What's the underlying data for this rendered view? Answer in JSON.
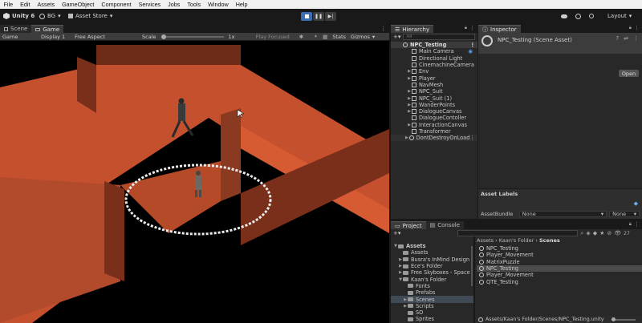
{
  "menu": [
    "File",
    "Edit",
    "Assets",
    "GameObject",
    "Component",
    "Services",
    "Jobs",
    "Tools",
    "Window",
    "Help"
  ],
  "toolbar": {
    "app": "Unity 6",
    "account": "BG",
    "asset_store": "Asset Store",
    "layout": "Layout"
  },
  "scene_tabs": {
    "scene": "Scene",
    "game": "Game"
  },
  "game_bar": {
    "mode": "Game",
    "display": "Display 1",
    "aspect": "Free Aspect",
    "scale_label": "Scale",
    "scale_value": "1x",
    "play_focused": "Play Focused",
    "stats": "Stats",
    "gizmos": "Gizmos"
  },
  "hierarchy": {
    "tab": "Hierarchy",
    "search_placeholder": "All",
    "scene": "NPC_Testing",
    "items": [
      {
        "label": "Main Camera",
        "indent": 1,
        "arrow": false
      },
      {
        "label": "Directional Light",
        "indent": 1,
        "arrow": false
      },
      {
        "label": "CinemachineCamera",
        "indent": 1,
        "arrow": false
      },
      {
        "label": "Env",
        "indent": 1,
        "arrow": true
      },
      {
        "label": "Player",
        "indent": 1,
        "arrow": true
      },
      {
        "label": "NavMesh",
        "indent": 1,
        "arrow": false
      },
      {
        "label": "NPC_Suit",
        "indent": 1,
        "arrow": true
      },
      {
        "label": "NPC_Suit (1)",
        "indent": 1,
        "arrow": true
      },
      {
        "label": "WanderPoints",
        "indent": 1,
        "arrow": true
      },
      {
        "label": "DialogueCanvas",
        "indent": 1,
        "arrow": true
      },
      {
        "label": "DialogueContoller",
        "indent": 1,
        "arrow": false
      },
      {
        "label": "InteractionCanvas",
        "indent": 1,
        "arrow": true
      },
      {
        "label": "Transformer",
        "indent": 1,
        "arrow": false
      }
    ],
    "dontdestroy": "DontDestroyOnLoad"
  },
  "inspector": {
    "tab": "Inspector",
    "title": "NPC_Testing (Scene Asset)",
    "open_btn": "Open",
    "asset_labels": "Asset Labels",
    "asset_bundle": "AssetBundle",
    "bundle_value": "None",
    "variant_value": "None"
  },
  "project": {
    "tab_project": "Project",
    "tab_console": "Console",
    "count": "27",
    "breadcrumb": [
      "Assets",
      "Kaan's Folder",
      "Scenes"
    ],
    "tree": [
      {
        "label": "Assets",
        "indent": 0,
        "arrow": "down",
        "bold": true
      },
      {
        "label": "Assets",
        "indent": 1,
        "arrow": ""
      },
      {
        "label": "Busra's InMind Design",
        "indent": 1,
        "arrow": "right"
      },
      {
        "label": "Ece's Folder",
        "indent": 1,
        "arrow": "right"
      },
      {
        "label": "Free Skyboxes - Space",
        "indent": 1,
        "arrow": "right"
      },
      {
        "label": "Kaan's Folder",
        "indent": 1,
        "arrow": "down"
      },
      {
        "label": "Fonts",
        "indent": 2,
        "arrow": ""
      },
      {
        "label": "Prefabs",
        "indent": 2,
        "arrow": ""
      },
      {
        "label": "Scenes",
        "indent": 2,
        "arrow": "right",
        "selected": true
      },
      {
        "label": "Scripts",
        "indent": 2,
        "arrow": "right"
      },
      {
        "label": "SO",
        "indent": 2,
        "arrow": ""
      },
      {
        "label": "Sprites",
        "indent": 2,
        "arrow": ""
      }
    ],
    "files": [
      {
        "label": "NPC_Testing",
        "selected": false
      },
      {
        "label": "Player_Movement",
        "selected": false
      },
      {
        "label": "MatrixPuzzle",
        "selected": false
      },
      {
        "label": "NPC_Testing",
        "selected": true
      },
      {
        "label": "Player_Movement",
        "selected": false
      },
      {
        "label": "QTE_Testing",
        "selected": false
      }
    ],
    "status_path": "Assets/Kaan's Folder/Scenes/NPC_Testing.unity"
  }
}
